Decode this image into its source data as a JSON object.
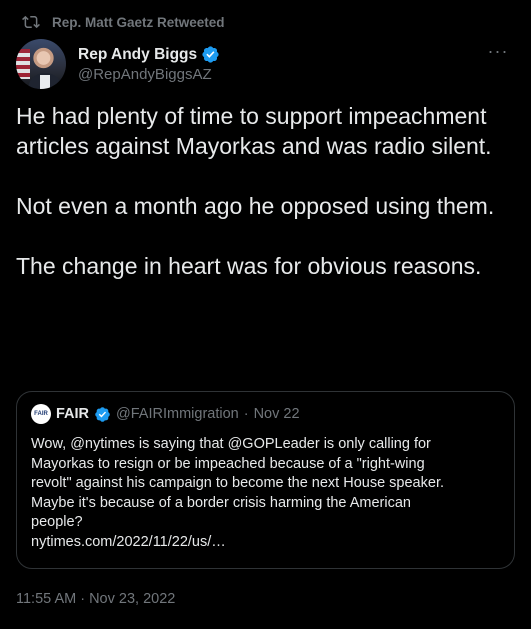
{
  "retweet": {
    "icon": "retweet-icon",
    "label": "Rep. Matt Gaetz Retweeted"
  },
  "author": {
    "name": "Rep Andy Biggs",
    "handle": "@RepAndyBiggsAZ",
    "verified_icon": "verified-badge-icon",
    "more_icon": "more-options-icon",
    "more_label": "···"
  },
  "body": {
    "paragraphs": [
      "He had plenty of time to support impeachment articles against Mayorkas and was radio silent.",
      "Not even a month ago he opposed using them.",
      "The change in heart was for obvious reasons."
    ]
  },
  "quote": {
    "avatar_text": "FAIR",
    "name": "FAIR",
    "handle": "@FAIRImmigration",
    "separator": "·",
    "date": "Nov 22",
    "lines": [
      "Wow, @nytimes is saying that @GOPLeader is only calling for",
      "Mayorkas to resign or be impeached because of a \"right-wing",
      "revolt\" against his campaign to become the next House speaker.",
      "Maybe it's because of a border crisis harming the American",
      "people?",
      "nytimes.com/2022/11/22/us/…"
    ]
  },
  "timestamp": "11:55 AM · Nov 23, 2022",
  "colors": {
    "background": "#000000",
    "text": "#e7e9ea",
    "secondary": "#71767b",
    "border": "#2f3336",
    "verified": "#1d9bf0"
  }
}
